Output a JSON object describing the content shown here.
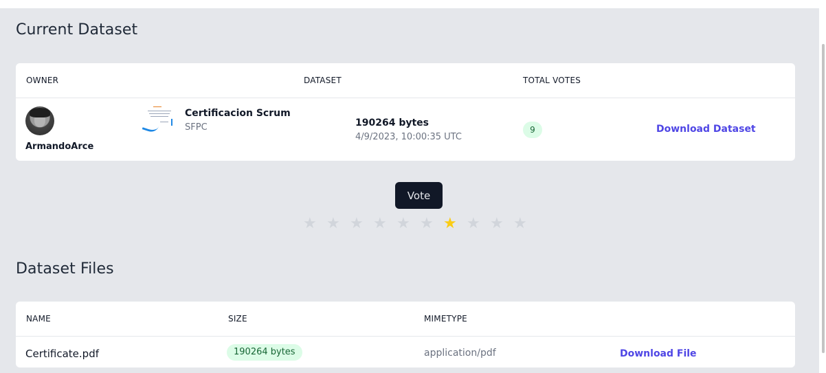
{
  "current_dataset": {
    "title": "Current Dataset",
    "headers": {
      "owner": "OWNER",
      "dataset": "DATASET",
      "total_votes": "TOTAL VOTES"
    },
    "row": {
      "owner_name": "ArmandoArce",
      "dataset_name": "Certificacion Scrum",
      "dataset_sub": "SFPC",
      "size": "190264 bytes",
      "date": "4/9/2023, 10:00:35 UTC",
      "votes": "9",
      "download_label": "Download Dataset"
    }
  },
  "vote": {
    "button_label": "Vote",
    "stars_total": 10,
    "selected_star": 7,
    "star_color_on": "#facc15",
    "star_color_off": "#d1d5db"
  },
  "dataset_files": {
    "title": "Dataset Files",
    "headers": {
      "name": "NAME",
      "size": "SIZE",
      "mimetype": "MIMETYPE"
    },
    "rows": [
      {
        "name": "Certificate.pdf",
        "size": "190264 bytes",
        "mimetype": "application/pdf",
        "download_label": "Download File"
      }
    ]
  },
  "colors": {
    "accent": "#4f46e5",
    "badge_bg": "#dcfce7",
    "page_bg": "#e5e7eb"
  }
}
